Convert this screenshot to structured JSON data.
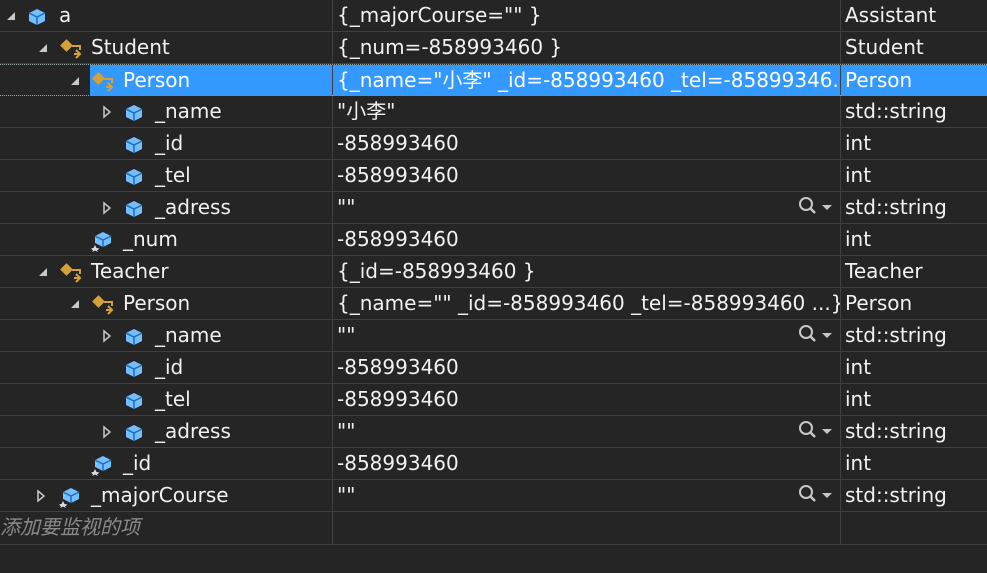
{
  "rows": [
    {
      "name": "a",
      "value": "{_majorCourse=\"\" }",
      "type": "Assistant"
    },
    {
      "name": "Student",
      "value": "{_num=-858993460 }",
      "type": "Student"
    },
    {
      "name": "Person",
      "value": "{_name=\"小李\" _id=-858993460 _tel=-85899346...",
      "type": "Person"
    },
    {
      "name": "_name",
      "value": "\"小李\"",
      "type": "std::string"
    },
    {
      "name": "_id",
      "value": "-858993460",
      "type": "int"
    },
    {
      "name": "_tel",
      "value": "-858993460",
      "type": "int"
    },
    {
      "name": "_adress",
      "value": "\"\"",
      "type": "std::string"
    },
    {
      "name": "_num",
      "value": "-858993460",
      "type": "int"
    },
    {
      "name": "Teacher",
      "value": "{_id=-858993460 }",
      "type": "Teacher"
    },
    {
      "name": "Person",
      "value": "{_name=\"\" _id=-858993460 _tel=-858993460 ...}",
      "type": "Person"
    },
    {
      "name": "_name",
      "value": "\"\"",
      "type": "std::string"
    },
    {
      "name": "_id",
      "value": "-858993460",
      "type": "int"
    },
    {
      "name": "_tel",
      "value": "-858993460",
      "type": "int"
    },
    {
      "name": "_adress",
      "value": "\"\"",
      "type": "std::string"
    },
    {
      "name": "_id",
      "value": "-858993460",
      "type": "int"
    },
    {
      "name": "_majorCourse",
      "value": "\"\"",
      "type": "std::string"
    }
  ],
  "add_watch_placeholder": "添加要监视的项",
  "colors": {
    "background": "#252526",
    "selection": "#3399ff",
    "grid": "#3f3f46",
    "field_icon": "#75beff",
    "class_icon": "#d7a13a"
  }
}
